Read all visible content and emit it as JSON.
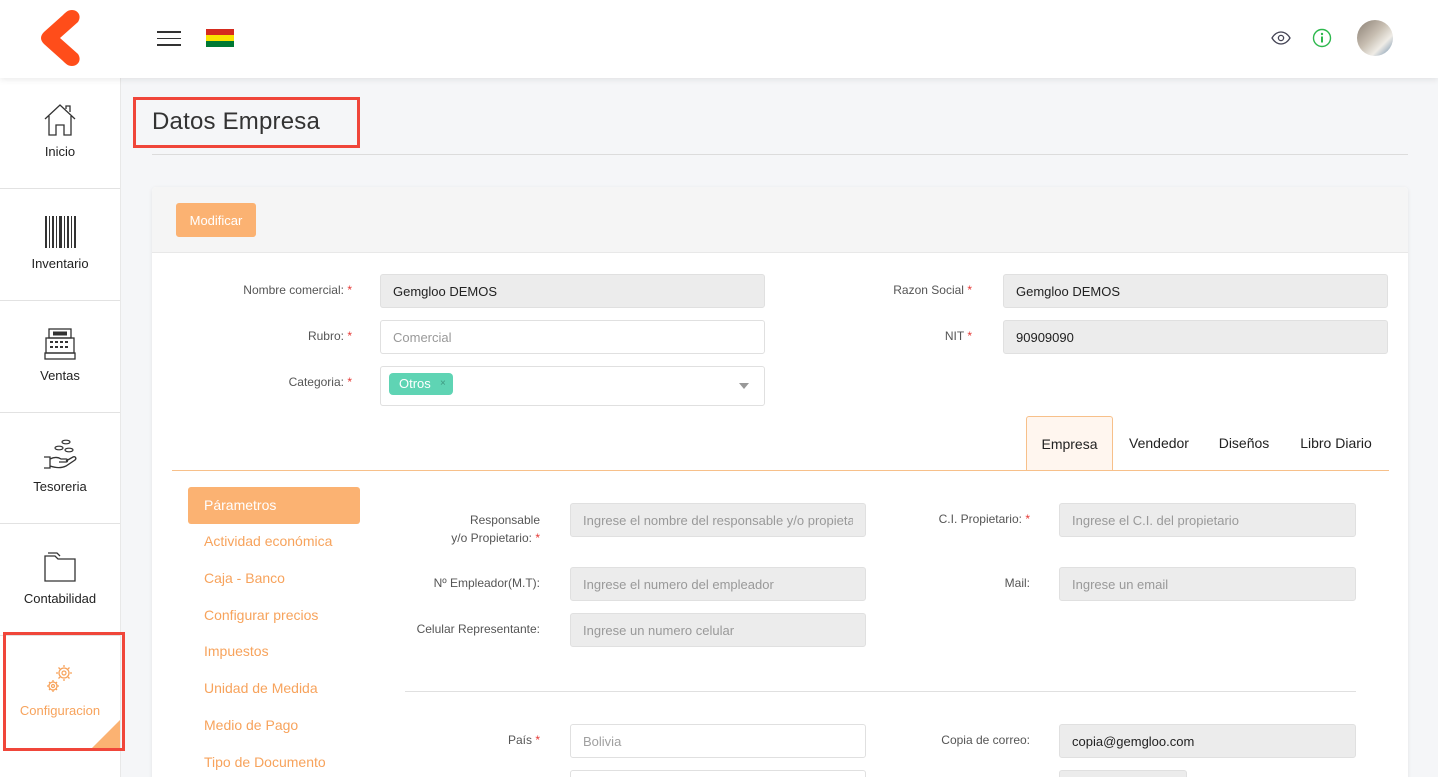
{
  "topbar": {
    "flag_colors": [
      "#d52b1e",
      "#f9e300",
      "#007934"
    ],
    "icons": [
      "menu-icon",
      "eye-icon",
      "info-icon",
      "avatar"
    ]
  },
  "sidebar": {
    "items": [
      {
        "label": "Inicio",
        "icon": "home-icon"
      },
      {
        "label": "Inventario",
        "icon": "barcode-icon"
      },
      {
        "label": "Ventas",
        "icon": "cash-register-icon"
      },
      {
        "label": "Tesoreria",
        "icon": "hand-coins-icon"
      },
      {
        "label": "Contabilidad",
        "icon": "folder-icon"
      },
      {
        "label": "Configuracion",
        "icon": "gears-icon",
        "active": true
      }
    ]
  },
  "page": {
    "title": "Datos Empresa"
  },
  "card": {
    "modify_label": "Modificar",
    "fields": {
      "nombre_comercial": {
        "label": "Nombre comercial:",
        "value": "Gemgloo DEMOS"
      },
      "razon_social": {
        "label": "Razon Social",
        "value": "Gemgloo DEMOS"
      },
      "rubro": {
        "label": "Rubro:",
        "placeholder": "Comercial"
      },
      "nit": {
        "label": "NIT",
        "value": "90909090"
      },
      "categoria": {
        "label": "Categoria:",
        "chip": "Otros",
        "chip_remove": "×"
      }
    },
    "required_mark": "*"
  },
  "tabs": [
    {
      "label": "Empresa",
      "active": true
    },
    {
      "label": "Vendedor"
    },
    {
      "label": "Diseños"
    },
    {
      "label": "Libro Diario"
    }
  ],
  "subnav": {
    "active": "Párametros",
    "items": [
      "Actividad económica",
      "Caja - Banco",
      "Configurar precios",
      "Impuestos",
      "Unidad de Medida",
      "Medio de Pago",
      "Tipo de Documento"
    ]
  },
  "empresa": {
    "responsable": {
      "label_line1": "Responsable",
      "label_line2": "y/o Propietario:",
      "placeholder": "Ingrese el nombre del responsable y/o propietario"
    },
    "ci": {
      "label": "C.I. Propietario:",
      "placeholder": "Ingrese el C.I. del propietario"
    },
    "empleador": {
      "label": "Nº Empleador(M.T):",
      "placeholder": "Ingrese el numero del empleador"
    },
    "mail": {
      "label": "Mail:",
      "placeholder": "Ingrese un email"
    },
    "celular": {
      "label": "Celular Representante:",
      "placeholder": "Ingrese un numero celular"
    },
    "pais": {
      "label": "País",
      "placeholder": "Bolivia"
    },
    "copia_correo": {
      "label": "Copia de correo:",
      "value": "copia@gemgloo.com"
    }
  },
  "colors": {
    "accent": "#fbb272",
    "accent_text": "#f7a35c",
    "chip": "#5fd4b4",
    "highlight_box": "#f0463a"
  }
}
